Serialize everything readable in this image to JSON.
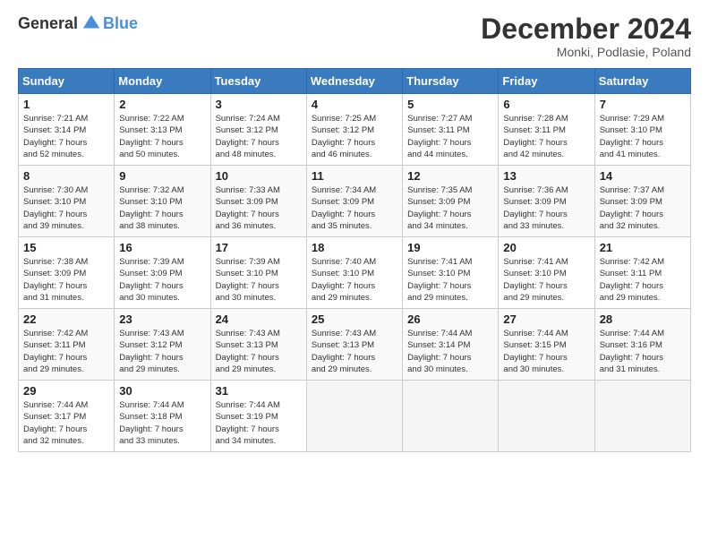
{
  "logo": {
    "general": "General",
    "blue": "Blue"
  },
  "header": {
    "month_title": "December 2024",
    "subtitle": "Monki, Podlasie, Poland"
  },
  "weekdays": [
    "Sunday",
    "Monday",
    "Tuesday",
    "Wednesday",
    "Thursday",
    "Friday",
    "Saturday"
  ],
  "weeks": [
    [
      {
        "day": 1,
        "info": "Sunrise: 7:21 AM\nSunset: 3:14 PM\nDaylight: 7 hours\nand 52 minutes."
      },
      {
        "day": 2,
        "info": "Sunrise: 7:22 AM\nSunset: 3:13 PM\nDaylight: 7 hours\nand 50 minutes."
      },
      {
        "day": 3,
        "info": "Sunrise: 7:24 AM\nSunset: 3:12 PM\nDaylight: 7 hours\nand 48 minutes."
      },
      {
        "day": 4,
        "info": "Sunrise: 7:25 AM\nSunset: 3:12 PM\nDaylight: 7 hours\nand 46 minutes."
      },
      {
        "day": 5,
        "info": "Sunrise: 7:27 AM\nSunset: 3:11 PM\nDaylight: 7 hours\nand 44 minutes."
      },
      {
        "day": 6,
        "info": "Sunrise: 7:28 AM\nSunset: 3:11 PM\nDaylight: 7 hours\nand 42 minutes."
      },
      {
        "day": 7,
        "info": "Sunrise: 7:29 AM\nSunset: 3:10 PM\nDaylight: 7 hours\nand 41 minutes."
      }
    ],
    [
      {
        "day": 8,
        "info": "Sunrise: 7:30 AM\nSunset: 3:10 PM\nDaylight: 7 hours\nand 39 minutes."
      },
      {
        "day": 9,
        "info": "Sunrise: 7:32 AM\nSunset: 3:10 PM\nDaylight: 7 hours\nand 38 minutes."
      },
      {
        "day": 10,
        "info": "Sunrise: 7:33 AM\nSunset: 3:09 PM\nDaylight: 7 hours\nand 36 minutes."
      },
      {
        "day": 11,
        "info": "Sunrise: 7:34 AM\nSunset: 3:09 PM\nDaylight: 7 hours\nand 35 minutes."
      },
      {
        "day": 12,
        "info": "Sunrise: 7:35 AM\nSunset: 3:09 PM\nDaylight: 7 hours\nand 34 minutes."
      },
      {
        "day": 13,
        "info": "Sunrise: 7:36 AM\nSunset: 3:09 PM\nDaylight: 7 hours\nand 33 minutes."
      },
      {
        "day": 14,
        "info": "Sunrise: 7:37 AM\nSunset: 3:09 PM\nDaylight: 7 hours\nand 32 minutes."
      }
    ],
    [
      {
        "day": 15,
        "info": "Sunrise: 7:38 AM\nSunset: 3:09 PM\nDaylight: 7 hours\nand 31 minutes."
      },
      {
        "day": 16,
        "info": "Sunrise: 7:39 AM\nSunset: 3:09 PM\nDaylight: 7 hours\nand 30 minutes."
      },
      {
        "day": 17,
        "info": "Sunrise: 7:39 AM\nSunset: 3:10 PM\nDaylight: 7 hours\nand 30 minutes."
      },
      {
        "day": 18,
        "info": "Sunrise: 7:40 AM\nSunset: 3:10 PM\nDaylight: 7 hours\nand 29 minutes."
      },
      {
        "day": 19,
        "info": "Sunrise: 7:41 AM\nSunset: 3:10 PM\nDaylight: 7 hours\nand 29 minutes."
      },
      {
        "day": 20,
        "info": "Sunrise: 7:41 AM\nSunset: 3:10 PM\nDaylight: 7 hours\nand 29 minutes."
      },
      {
        "day": 21,
        "info": "Sunrise: 7:42 AM\nSunset: 3:11 PM\nDaylight: 7 hours\nand 29 minutes."
      }
    ],
    [
      {
        "day": 22,
        "info": "Sunrise: 7:42 AM\nSunset: 3:11 PM\nDaylight: 7 hours\nand 29 minutes."
      },
      {
        "day": 23,
        "info": "Sunrise: 7:43 AM\nSunset: 3:12 PM\nDaylight: 7 hours\nand 29 minutes."
      },
      {
        "day": 24,
        "info": "Sunrise: 7:43 AM\nSunset: 3:13 PM\nDaylight: 7 hours\nand 29 minutes."
      },
      {
        "day": 25,
        "info": "Sunrise: 7:43 AM\nSunset: 3:13 PM\nDaylight: 7 hours\nand 29 minutes."
      },
      {
        "day": 26,
        "info": "Sunrise: 7:44 AM\nSunset: 3:14 PM\nDaylight: 7 hours\nand 30 minutes."
      },
      {
        "day": 27,
        "info": "Sunrise: 7:44 AM\nSunset: 3:15 PM\nDaylight: 7 hours\nand 30 minutes."
      },
      {
        "day": 28,
        "info": "Sunrise: 7:44 AM\nSunset: 3:16 PM\nDaylight: 7 hours\nand 31 minutes."
      }
    ],
    [
      {
        "day": 29,
        "info": "Sunrise: 7:44 AM\nSunset: 3:17 PM\nDaylight: 7 hours\nand 32 minutes."
      },
      {
        "day": 30,
        "info": "Sunrise: 7:44 AM\nSunset: 3:18 PM\nDaylight: 7 hours\nand 33 minutes."
      },
      {
        "day": 31,
        "info": "Sunrise: 7:44 AM\nSunset: 3:19 PM\nDaylight: 7 hours\nand 34 minutes."
      },
      null,
      null,
      null,
      null
    ]
  ]
}
